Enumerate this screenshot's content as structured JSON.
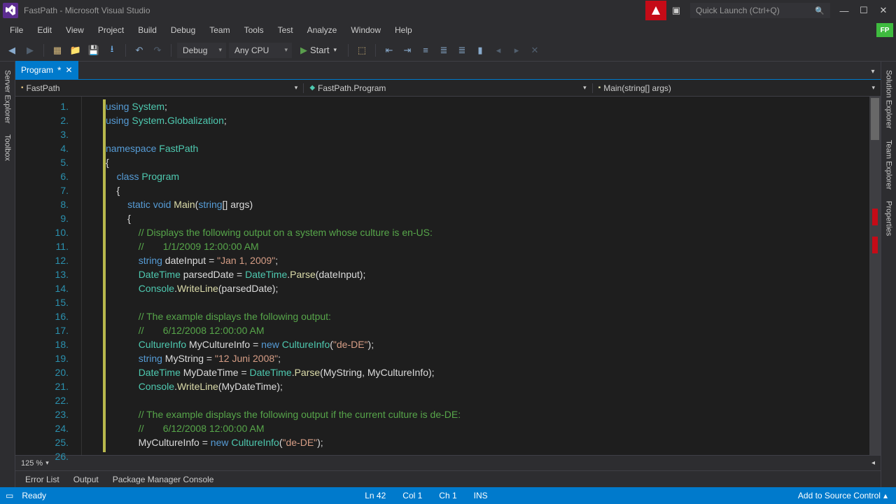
{
  "title": "FastPath - Microsoft Visual Studio",
  "quick_launch_placeholder": "Quick Launch (Ctrl+Q)",
  "badge": "FP",
  "menu": [
    "File",
    "Edit",
    "View",
    "Project",
    "Build",
    "Debug",
    "Team",
    "Tools",
    "Test",
    "Analyze",
    "Window",
    "Help"
  ],
  "toolbar": {
    "config": "Debug",
    "platform": "Any CPU",
    "start": "Start"
  },
  "left_panels": [
    "Server Explorer",
    "Toolbox"
  ],
  "right_panels": [
    "Solution Explorer",
    "Team Explorer",
    "Properties"
  ],
  "tab": {
    "name": "Program",
    "dirty": "*"
  },
  "nav": {
    "project": "FastPath",
    "type": "FastPath.Program",
    "member": "Main(string[] args)"
  },
  "code_lines": [
    {
      "n": "1.",
      "h": "<span class='kw'>using</span> <span class='cls'>System</span>;"
    },
    {
      "n": "2.",
      "h": "<span class='kw'>using</span> <span class='cls'>System</span>.<span class='cls'>Globalization</span>;"
    },
    {
      "n": "3.",
      "h": ""
    },
    {
      "n": "4.",
      "h": "<span class='kw'>namespace</span> <span class='cls'>FastPath</span>"
    },
    {
      "n": "5.",
      "h": "{"
    },
    {
      "n": "6.",
      "h": "    <span class='kw'>class</span> <span class='cls'>Program</span>"
    },
    {
      "n": "7.",
      "h": "    {"
    },
    {
      "n": "8.",
      "h": "        <span class='kw'>static</span> <span class='kw'>void</span> <span class='mth'>Main</span>(<span class='kw'>string</span>[] args)"
    },
    {
      "n": "9.",
      "h": "        {"
    },
    {
      "n": "10.",
      "h": "            <span class='cmt'>// Displays the following output on a system whose culture is en-US:</span>"
    },
    {
      "n": "11.",
      "h": "            <span class='cmt'>//       1/1/2009 12:00:00 AM</span>"
    },
    {
      "n": "12.",
      "h": "            <span class='kw'>string</span> dateInput = <span class='str'>\"Jan 1, 2009\"</span>;"
    },
    {
      "n": "13.",
      "h": "            <span class='cls'>DateTime</span> parsedDate = <span class='cls'>DateTime</span>.<span class='mth'>Parse</span>(dateInput);"
    },
    {
      "n": "14.",
      "h": "            <span class='cls'>Console</span>.<span class='mth'>WriteLine</span>(parsedDate);"
    },
    {
      "n": "15.",
      "h": ""
    },
    {
      "n": "16.",
      "h": "            <span class='cmt'>// The example displays the following output:</span>"
    },
    {
      "n": "17.",
      "h": "            <span class='cmt'>//       6/12/2008 12:00:00 AM</span>"
    },
    {
      "n": "18.",
      "h": "            <span class='cls'>CultureInfo</span> MyCultureInfo = <span class='kw'>new</span> <span class='cls'>CultureInfo</span>(<span class='str'>\"de-DE\"</span>);"
    },
    {
      "n": "19.",
      "h": "            <span class='kw'>string</span> MyString = <span class='str'>\"12 Juni 2008\"</span>;"
    },
    {
      "n": "20.",
      "h": "            <span class='cls'>DateTime</span> MyDateTime = <span class='cls'>DateTime</span>.<span class='mth'>Parse</span>(MyString, MyCultureInfo);"
    },
    {
      "n": "21.",
      "h": "            <span class='cls'>Console</span>.<span class='mth'>WriteLine</span>(MyDateTime);"
    },
    {
      "n": "22.",
      "h": ""
    },
    {
      "n": "23.",
      "h": "            <span class='cmt'>// The example displays the following output if the current culture is de-DE:</span>"
    },
    {
      "n": "24.",
      "h": "            <span class='cmt'>//       6/12/2008 12:00:00 AM</span>"
    },
    {
      "n": "25.",
      "h": "            MyCultureInfo = <span class='kw'>new</span> <span class='cls'>CultureInfo</span>(<span class='str'>\"de-DE\"</span>);"
    },
    {
      "n": "26.",
      "h": ""
    }
  ],
  "zoom": "125 %",
  "bottom_tabs": [
    "Error List",
    "Output",
    "Package Manager Console"
  ],
  "status": {
    "ready": "Ready",
    "ln": "Ln 42",
    "col": "Col 1",
    "ch": "Ch 1",
    "ins": "INS",
    "add": "Add to Source Control"
  }
}
